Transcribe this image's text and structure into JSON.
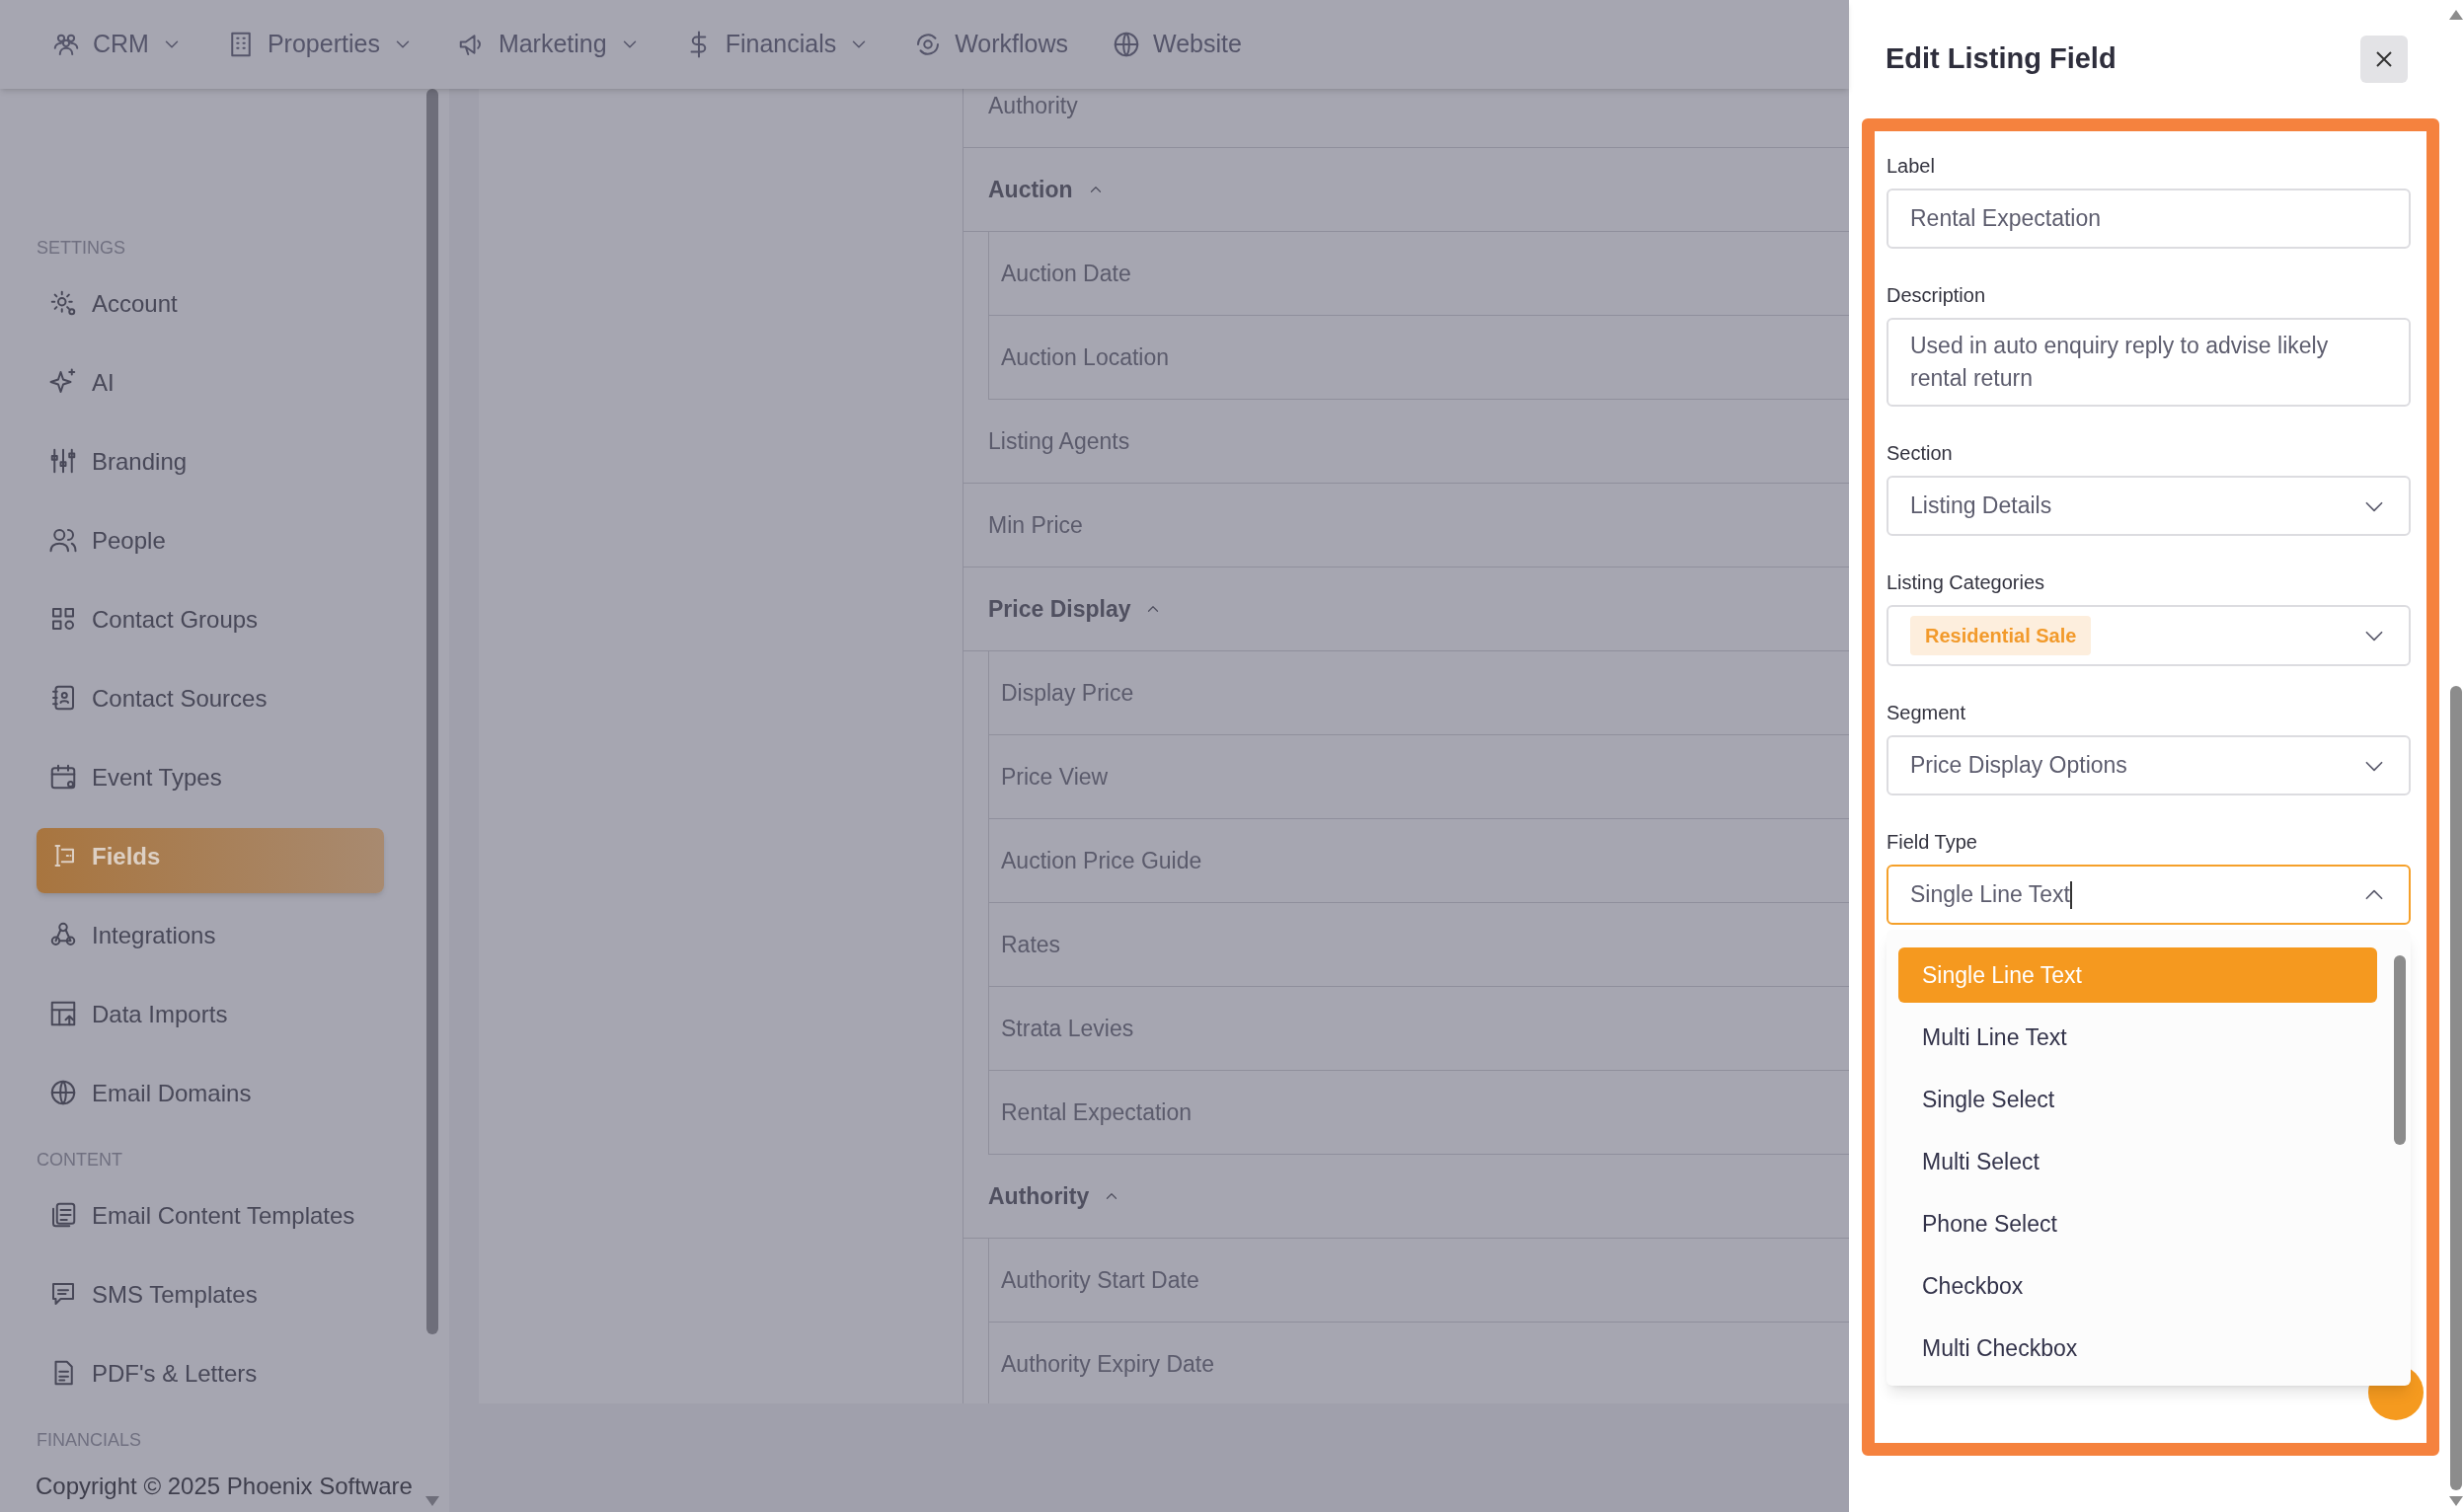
{
  "nav": [
    {
      "label": "CRM",
      "dropdown": true
    },
    {
      "label": "Properties",
      "dropdown": true
    },
    {
      "label": "Marketing",
      "dropdown": true
    },
    {
      "label": "Financials",
      "dropdown": true
    },
    {
      "label": "Workflows",
      "dropdown": false
    },
    {
      "label": "Website",
      "dropdown": false
    }
  ],
  "sidebar": {
    "sections": [
      {
        "title": "SETTINGS",
        "items": [
          {
            "label": "Account",
            "selected": false
          },
          {
            "label": "AI",
            "selected": false
          },
          {
            "label": "Branding",
            "selected": false
          },
          {
            "label": "People",
            "selected": false
          },
          {
            "label": "Contact Groups",
            "selected": false
          },
          {
            "label": "Contact Sources",
            "selected": false
          },
          {
            "label": "Event Types",
            "selected": false
          },
          {
            "label": "Fields",
            "selected": true
          },
          {
            "label": "Integrations",
            "selected": false
          },
          {
            "label": "Data Imports",
            "selected": false
          },
          {
            "label": "Email Domains",
            "selected": false
          }
        ]
      },
      {
        "title": "CONTENT",
        "items": [
          {
            "label": "Email Content Templates",
            "selected": false
          },
          {
            "label": "SMS Templates",
            "selected": false
          },
          {
            "label": "PDF's & Letters",
            "selected": false
          }
        ]
      },
      {
        "title": "FINANCIALS"
      }
    ],
    "footer": "Copyright © 2025 Phoenix Software"
  },
  "tree": [
    {
      "label": "Authority"
    },
    {
      "label": "Auction",
      "expanded": true,
      "children": [
        {
          "label": "Auction Date"
        },
        {
          "label": "Auction Location"
        }
      ]
    },
    {
      "label": "Listing Agents"
    },
    {
      "label": "Min Price"
    },
    {
      "label": "Price Display",
      "expanded": true,
      "children": [
        {
          "label": "Display Price"
        },
        {
          "label": "Price View"
        },
        {
          "label": "Auction Price Guide"
        },
        {
          "label": "Rates"
        },
        {
          "label": "Strata Levies"
        },
        {
          "label": "Rental Expectation"
        }
      ]
    },
    {
      "label": "Authority",
      "expanded": true,
      "children": [
        {
          "label": "Authority Start Date"
        },
        {
          "label": "Authority Expiry Date"
        }
      ]
    }
  ],
  "panel": {
    "title": "Edit Listing Field",
    "fields": [
      {
        "kind": "text",
        "label": "Label",
        "value": "Rental Expectation"
      },
      {
        "kind": "textarea",
        "label": "Description",
        "value": "Used in auto enquiry reply to advise likely rental return"
      },
      {
        "kind": "select",
        "label": "Section",
        "value": "Listing Details"
      },
      {
        "kind": "tags",
        "label": "Listing Categories",
        "tags": [
          "Residential Sale"
        ]
      },
      {
        "kind": "select",
        "label": "Segment",
        "value": "Price Display Options"
      },
      {
        "kind": "combobox",
        "label": "Field Type",
        "value": "Single Line Text",
        "open": true,
        "options": [
          {
            "label": "Single Line Text",
            "selected": true
          },
          {
            "label": "Multi Line Text",
            "selected": false
          },
          {
            "label": "Single Select",
            "selected": false
          },
          {
            "label": "Multi Select",
            "selected": false
          },
          {
            "label": "Phone Select",
            "selected": false
          },
          {
            "label": "Checkbox",
            "selected": false
          },
          {
            "label": "Multi Checkbox",
            "selected": false
          }
        ]
      }
    ]
  }
}
